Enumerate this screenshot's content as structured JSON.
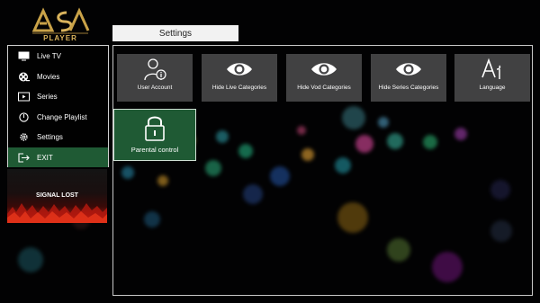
{
  "brand": {
    "logo_text": "PLAYER"
  },
  "header": {
    "title": "Settings"
  },
  "sidebar": {
    "items": [
      {
        "label": "Live TV",
        "icon": "tv-icon"
      },
      {
        "label": "Movies",
        "icon": "film-reel-icon"
      },
      {
        "label": "Series",
        "icon": "play-screen-icon"
      },
      {
        "label": "Change Playlist",
        "icon": "power-icon"
      },
      {
        "label": "Settings",
        "icon": "gear-icon"
      },
      {
        "label": "EXIT",
        "icon": "exit-icon",
        "active": true
      }
    ]
  },
  "signal_panel": {
    "text": "SIGNAL LOST"
  },
  "settings": {
    "tiles": [
      {
        "label": "User Account",
        "icon": "user-info-icon"
      },
      {
        "label": "Hide Live Categories",
        "icon": "eye-icon"
      },
      {
        "label": "Hide Vod Categories",
        "icon": "eye-icon"
      },
      {
        "label": "Hide Series Categories",
        "icon": "eye-icon"
      },
      {
        "label": "Language",
        "icon": "language-icon"
      },
      {
        "label": "Parental control",
        "icon": "lock-icon",
        "selected": true
      }
    ]
  },
  "colors": {
    "accent_green": "#1f5a34",
    "tile_gray": "#464648",
    "logo_gold": "#d9b35c"
  }
}
